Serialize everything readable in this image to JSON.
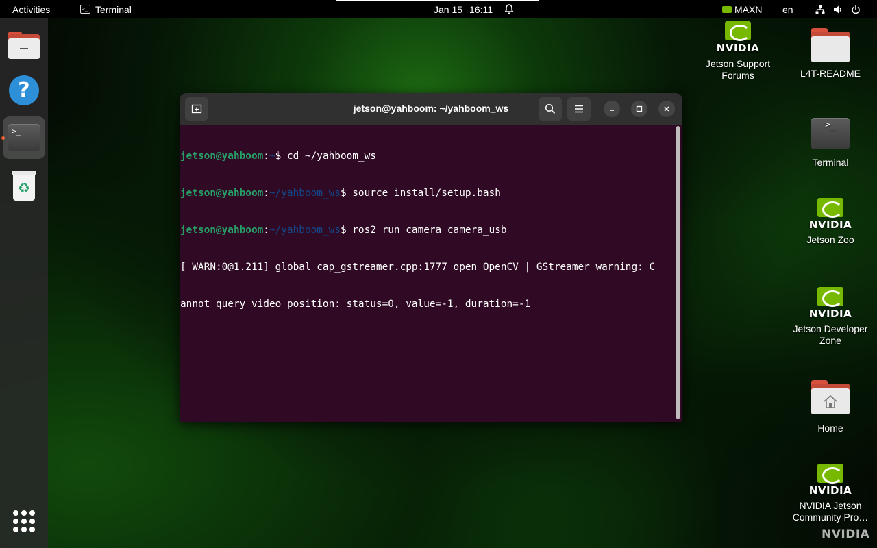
{
  "topbar": {
    "activities": "Activities",
    "app_name": "Terminal",
    "date": "Jan 15",
    "time": "16:11",
    "power_mode": "MAXN",
    "language": "en"
  },
  "dock": {
    "items": [
      {
        "name": "Files",
        "icon": "folder-icon"
      },
      {
        "name": "Help",
        "icon": "help-icon"
      },
      {
        "name": "Terminal",
        "icon": "terminal-icon",
        "running": true
      },
      {
        "name": "Trash",
        "icon": "trash-icon"
      }
    ],
    "show_apps_icon": "grid-icon"
  },
  "window": {
    "title": "jetson@yahboom: ~/yahboom_ws",
    "terminal": {
      "lines": [
        {
          "user": "jetson@yahboom",
          "sep": ":",
          "path": "~",
          "prompt": "$ ",
          "cmd": "cd ~/yahboom_ws"
        },
        {
          "user": "jetson@yahboom",
          "sep": ":",
          "path": "~/yahboom_ws",
          "prompt": "$ ",
          "cmd": "source install/setup.bash"
        },
        {
          "user": "jetson@yahboom",
          "sep": ":",
          "path": "~/yahboom_ws",
          "prompt": "$ ",
          "cmd": "ros2 run camera camera_usb"
        }
      ],
      "output": [
        "[ WARN:0@1.211] global cap_gstreamer.cpp:1777 open OpenCV | GStreamer warning: C",
        "annot query video position: status=0, value=-1, duration=-1"
      ]
    }
  },
  "desktop": {
    "icons": [
      {
        "label": "Jetson Support\nForums",
        "icon": "nvidia-logo"
      },
      {
        "label": "L4T-README",
        "icon": "folder-icon"
      },
      {
        "label": "Terminal",
        "icon": "terminal-icon"
      },
      {
        "label": "Jetson Zoo",
        "icon": "nvidia-logo"
      },
      {
        "label": "Jetson Developer\nZone",
        "icon": "nvidia-logo"
      },
      {
        "label": "Home",
        "icon": "home-folder-icon"
      },
      {
        "label": "NVIDIA Jetson\nCommunity Pro…",
        "icon": "nvidia-logo"
      }
    ],
    "nvidia_wordmark": "NVIDIA"
  },
  "colors": {
    "terminal_bg": "#300a24",
    "prompt_user": "#26a269",
    "prompt_path": "#12488b",
    "nvidia_green": "#76b900",
    "running_dot": "#e95420"
  }
}
